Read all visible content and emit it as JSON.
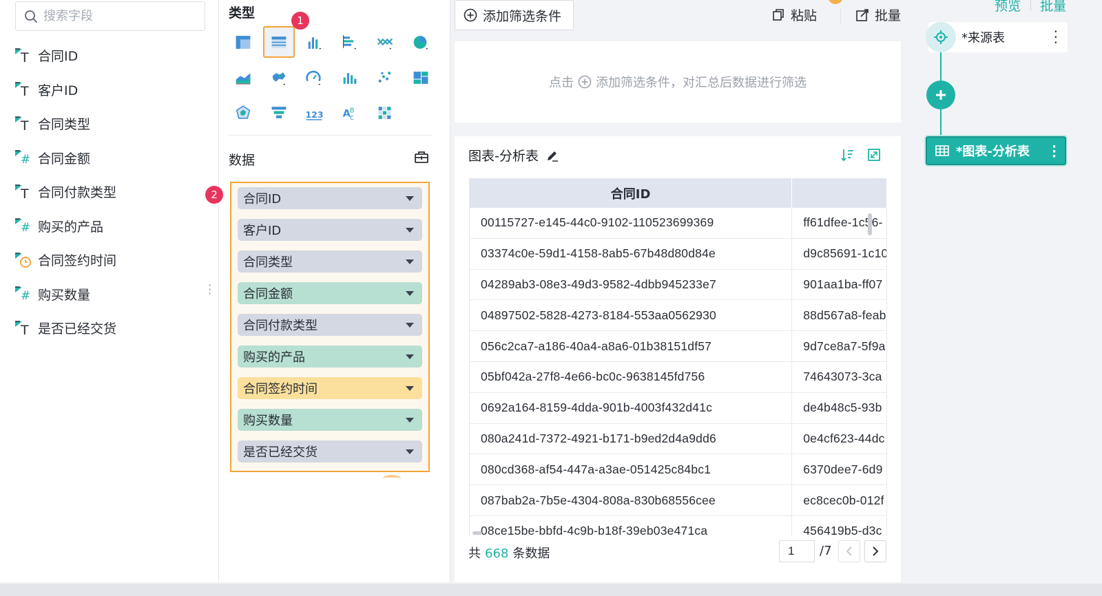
{
  "search": {
    "placeholder": "搜索字段"
  },
  "fields": [
    {
      "label": "合同ID",
      "type": "text"
    },
    {
      "label": "客户ID",
      "type": "text"
    },
    {
      "label": "合同类型",
      "type": "text"
    },
    {
      "label": "合同金额",
      "type": "number"
    },
    {
      "label": "合同付款类型",
      "type": "text"
    },
    {
      "label": "购买的产品",
      "type": "number"
    },
    {
      "label": "合同签约时间",
      "type": "date"
    },
    {
      "label": "购买数量",
      "type": "number"
    },
    {
      "label": "是否已经交货",
      "type": "text"
    }
  ],
  "config": {
    "type_title": "类型",
    "badge1": "1",
    "badge2": "2",
    "data_title": "数据",
    "chart_types": [
      "cross-table-icon",
      "detail-table-icon",
      "bar-chart-icon",
      "stacked-bar-icon",
      "line-chart-icon",
      "pie-chart-icon",
      "area-chart-icon",
      "map-icon",
      "gauge-icon",
      "histogram-icon",
      "scatter-icon",
      "treemap-icon",
      "radar-icon",
      "funnel-icon",
      "kpi-number-icon",
      "word-cloud-icon",
      "heatmap-icon"
    ],
    "selected_type": "detail-table-icon",
    "data_fields": [
      {
        "label": "合同ID",
        "kind": "dim"
      },
      {
        "label": "客户ID",
        "kind": "dim"
      },
      {
        "label": "合同类型",
        "kind": "dim"
      },
      {
        "label": "合同金额",
        "kind": "measure"
      },
      {
        "label": "合同付款类型",
        "kind": "dim"
      },
      {
        "label": "购买的产品",
        "kind": "measure"
      },
      {
        "label": "合同签约时间",
        "kind": "date"
      },
      {
        "label": "购买数量",
        "kind": "measure"
      },
      {
        "label": "是否已经交货",
        "kind": "dim"
      }
    ]
  },
  "toolbar": {
    "add_filter": "添加筛选条件",
    "paste": "粘贴",
    "batch": "批量"
  },
  "filter_hint": {
    "prefix": "点击",
    "suffix": "添加筛选条件，对汇总后数据进行筛选"
  },
  "table": {
    "title": "图表-分析表",
    "columns": [
      "合同ID",
      ""
    ],
    "rows": [
      [
        "00115727-e145-44c0-9102-110523699369",
        "ff61dfee-1c56-"
      ],
      [
        "03374c0e-59d1-4158-8ab5-67b48d80d84e",
        "d9c85691-1c10"
      ],
      [
        "04289ab3-08e3-49d3-9582-4dbb945233e7",
        "901aa1ba-ff07"
      ],
      [
        "04897502-5828-4273-8184-553aa0562930",
        "88d567a8-feab"
      ],
      [
        "056c2ca7-a186-40a4-a8a6-01b38151df57",
        "9d7ce8a7-5f9a"
      ],
      [
        "05bf042a-27f8-4e66-bc0c-9638145fd756",
        "74643073-3ca"
      ],
      [
        "0692a164-8159-4dda-901b-4003f432d41c",
        "de4b48c5-93b"
      ],
      [
        "080a241d-7372-4921-b171-b9ed2d4a9dd6",
        "0e4cf623-44dc"
      ],
      [
        "080cd368-af54-447a-a3ae-051425c84bc1",
        "6370dee7-6d9"
      ],
      [
        "087bab2a-7b5e-4304-808a-830b68556cee",
        "ec8cec0b-012f"
      ],
      [
        "08ce15be-bbfd-4c9b-b18f-39eb03e471ca",
        "456419b5-d3c"
      ]
    ],
    "footer_prefix": "共",
    "total": "668",
    "footer_suffix": "条数据",
    "page": "1",
    "page_total": "/7"
  },
  "flow": {
    "preview": "预览",
    "batch": "批量",
    "source_node": "*来源表",
    "chart_node": "*图表-分析表"
  },
  "colors": {
    "accent": "#1fb3a8",
    "highlight": "#f3a53a",
    "badge": "#e8355d",
    "dim_pill": "#d4d8e2",
    "measure_pill": "#b7dfd2",
    "date_pill": "#fbdf9c"
  }
}
